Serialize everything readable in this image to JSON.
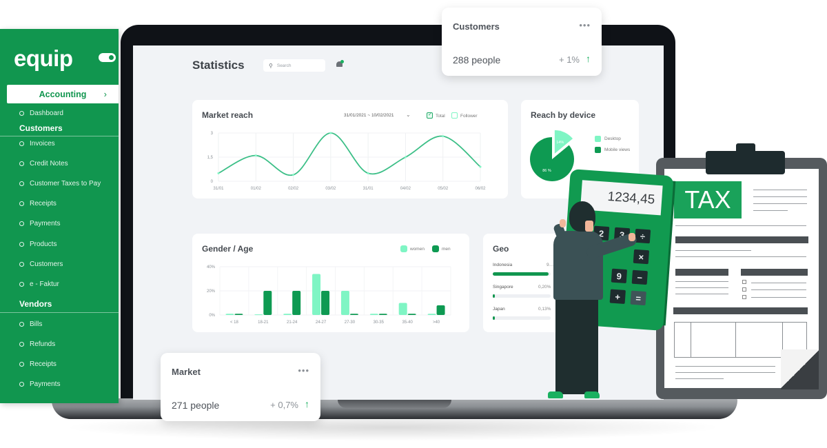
{
  "sidebar": {
    "logo": "equip",
    "active_section": "Accounting",
    "items_top": [
      {
        "label": "Dashboard"
      }
    ],
    "groups": [
      {
        "heading": "Customers",
        "items": [
          {
            "label": "Invoices"
          },
          {
            "label": "Credit Notes"
          },
          {
            "label": "Customer Taxes to Pay"
          },
          {
            "label": "Receipts"
          },
          {
            "label": "Payments"
          },
          {
            "label": "Products"
          },
          {
            "label": "Customers"
          },
          {
            "label": "e - Faktur"
          }
        ]
      },
      {
        "heading": "Vendors",
        "items": [
          {
            "label": "Bills"
          },
          {
            "label": "Refunds"
          },
          {
            "label": "Receipts"
          },
          {
            "label": "Payments"
          }
        ]
      }
    ]
  },
  "header": {
    "title": "Statistics",
    "search_placeholder": "Search"
  },
  "market_reach": {
    "title": "Market reach",
    "date_range": "31/01/2021 ~ 10/02/2021",
    "legend": [
      {
        "label": "Total",
        "checked": true
      },
      {
        "label": "Follower",
        "checked": false
      }
    ]
  },
  "reach_by_device": {
    "title": "Reach by device",
    "legend": [
      "Desktop",
      "Mobile views"
    ]
  },
  "gender_age": {
    "title": "Gender / Age",
    "legend": [
      "women",
      "men"
    ]
  },
  "geo": {
    "title": "Geo",
    "rows": [
      {
        "country": "Indonesia",
        "value": "9…",
        "fraction": 0.96
      },
      {
        "country": "Singapore",
        "value": "0,20%",
        "fraction": 0.02
      },
      {
        "country": "Japan",
        "value": "0,13%",
        "fraction": 0.013
      }
    ]
  },
  "stat_cards": {
    "customers": {
      "title": "Customers",
      "value": "288 people",
      "change": "+ 1%",
      "trend": "up"
    },
    "market": {
      "title": "Market",
      "value": "271 people",
      "change": "+ 0,7%",
      "trend": "up"
    }
  },
  "illustration": {
    "calculator_display": "1234,45",
    "calculator_keys": [
      "2",
      "3",
      "÷",
      "×",
      "9",
      "−",
      "+",
      "="
    ],
    "document_label": "TAX"
  },
  "colors": {
    "brand": "#11964f",
    "accent_light": "#7ff5c4",
    "accent_dark": "#0e9a52",
    "trend_up": "#1ab060"
  },
  "chart_data": [
    {
      "type": "line",
      "title": "Market reach",
      "x": [
        "31/01",
        "01/02",
        "02/02",
        "03/02",
        "31/01",
        "04/02",
        "05/02",
        "06/02"
      ],
      "series": [
        {
          "name": "Total",
          "values": [
            0.5,
            1.6,
            0.4,
            3.0,
            0.5,
            1.5,
            2.8,
            0.9
          ]
        }
      ],
      "yticks": [
        "0",
        "1,5",
        "3"
      ],
      "ylim": [
        0,
        3
      ],
      "grid": true,
      "legend": "top-right"
    },
    {
      "type": "pie",
      "title": "Reach by device",
      "slices": [
        {
          "label": "Desktop",
          "value": 14,
          "text": "14%"
        },
        {
          "label": "Mobile views",
          "value": 86,
          "text": "86 %"
        }
      ],
      "legend": "right"
    },
    {
      "type": "bar",
      "title": "Gender / Age",
      "categories": [
        "< 18",
        "18-21",
        "21-24",
        "24-27",
        "27-30",
        "30-35",
        "35-40",
        ">40"
      ],
      "series": [
        {
          "name": "women",
          "values": [
            1,
            0.5,
            1,
            34,
            20,
            1,
            10,
            1
          ]
        },
        {
          "name": "men",
          "values": [
            1,
            20,
            20,
            20,
            1,
            1,
            1,
            8
          ]
        }
      ],
      "yticks": [
        "0%",
        "20%",
        "40%"
      ],
      "ylim": [
        0,
        40
      ],
      "grid": true,
      "legend": "top-right"
    }
  ]
}
